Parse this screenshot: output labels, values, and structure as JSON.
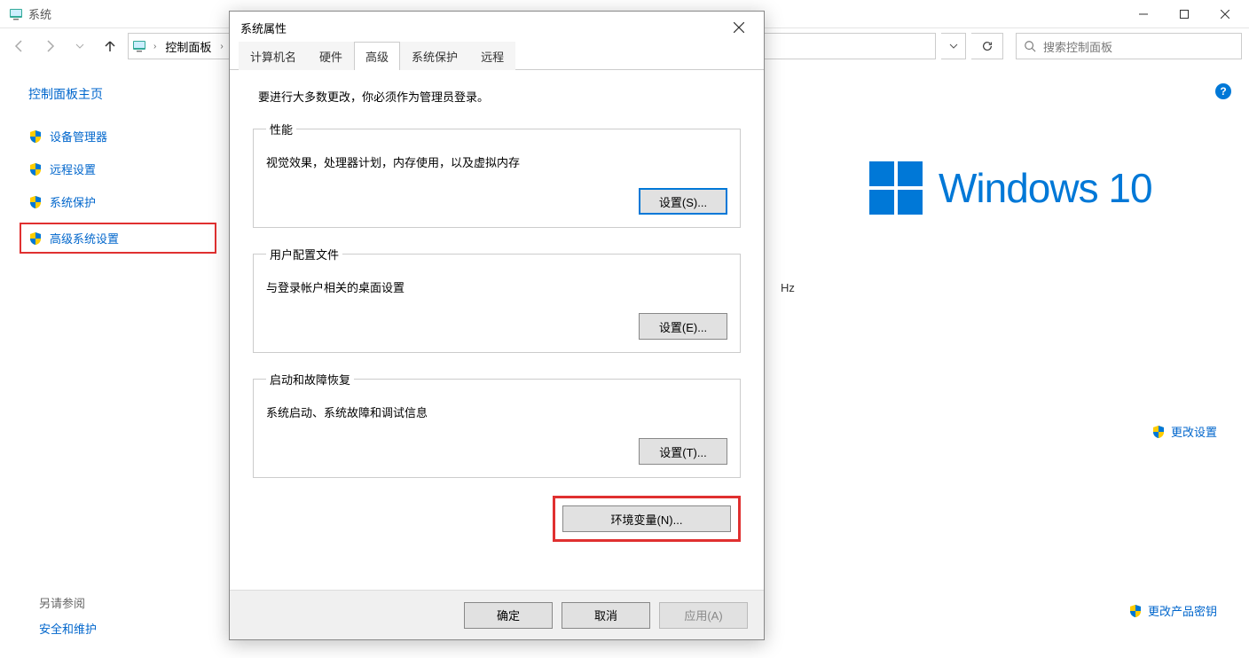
{
  "window": {
    "title": "系统",
    "min": "Minimize",
    "max": "Maximize",
    "close": "Close"
  },
  "nav": {
    "breadcrumb": "控制面板",
    "search_placeholder": "搜索控制面板"
  },
  "help_badge": "?",
  "sidebar": {
    "home": "控制面板主页",
    "items": [
      "设备管理器",
      "远程设置",
      "系统保护",
      "高级系统设置"
    ],
    "also_see_hdr": "另请参阅",
    "also_see_link": "安全和维护"
  },
  "main": {
    "windows_logo_text": "Windows 10",
    "hz": "Hz",
    "change_settings": "更改设置",
    "change_product_key": "更改产品密钥"
  },
  "dialog": {
    "title": "系统属性",
    "tabs": [
      "计算机名",
      "硬件",
      "高级",
      "系统保护",
      "远程"
    ],
    "active_tab": "高级",
    "admin_note": "要进行大多数更改，你必须作为管理员登录。",
    "perf": {
      "legend": "性能",
      "desc": "视觉效果，处理器计划，内存使用，以及虚拟内存",
      "btn": "设置(S)..."
    },
    "profile": {
      "legend": "用户配置文件",
      "desc": "与登录帐户相关的桌面设置",
      "btn": "设置(E)..."
    },
    "startup": {
      "legend": "启动和故障恢复",
      "desc": "系统启动、系统故障和调试信息",
      "btn": "设置(T)..."
    },
    "env_btn": "环境变量(N)...",
    "ok": "确定",
    "cancel": "取消",
    "apply": "应用(A)"
  }
}
